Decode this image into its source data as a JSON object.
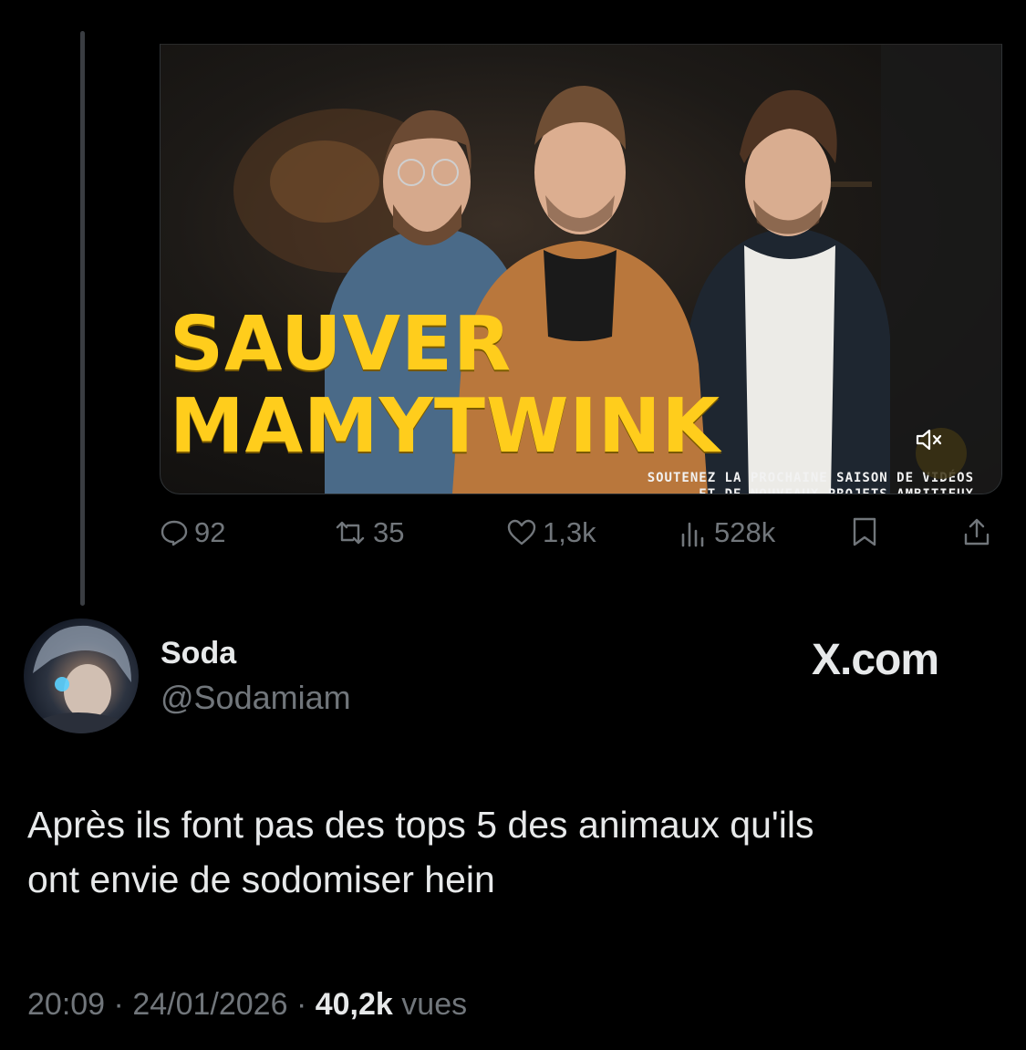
{
  "video": {
    "title_line1": "SAUVER",
    "title_line2": "MAMYTWINK",
    "caption_line1": "SOUTENEZ LA PROCHAINE SAISON DE VIDÉOS",
    "caption_line2": "ET DE NOUVEAUX PROJETS AMBITIEUX",
    "mute_icon": "speaker-muted-icon"
  },
  "actions": {
    "replies": "92",
    "reposts": "35",
    "likes": "1,3k",
    "views": "528k"
  },
  "author": {
    "name": "Soda",
    "handle": "@Sodamiam"
  },
  "brand": "X.com",
  "tweet": {
    "line1": "Après ils font pas des tops 5 des animaux qu'ils",
    "line2": "ont envie de sodomiser hein"
  },
  "meta": {
    "time": "20:09",
    "date": "24/01/2026",
    "views_count": "40,2k",
    "views_label": "vues"
  },
  "colors": {
    "background": "#000000",
    "text": "#e7e9ea",
    "muted": "#71767b",
    "title_yellow": "#ffcd1c"
  }
}
